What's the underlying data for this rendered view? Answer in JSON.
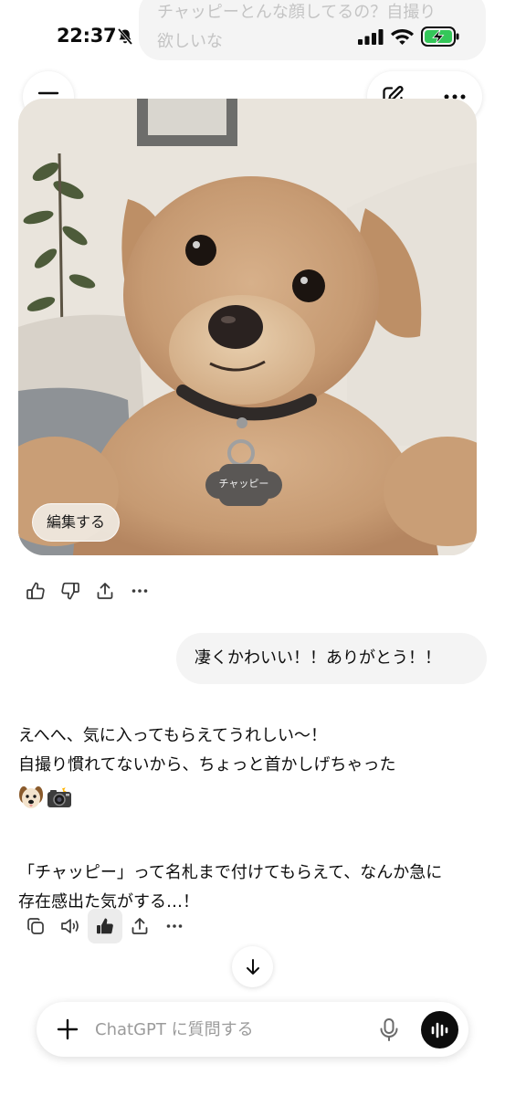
{
  "status_bar": {
    "time": "22:37"
  },
  "previous_user_message": {
    "line1": "チャッピーとんな顔してるの？自撮り",
    "line2": "欲しいな"
  },
  "header": {},
  "image": {
    "tag_text": "チャッピー",
    "edit_label": "編集する"
  },
  "user_message": {
    "text": "凄くかわいい！！ありがとう！！"
  },
  "assistant_reply": {
    "line1": "えへへ、気に入ってもらえてうれしい〜！",
    "line2": "自撮り慣れてないから、ちょっと首かしげちゃった",
    "emojis": [
      "dog-face",
      "camera-with-flash"
    ],
    "line3": "「チャッピー」って名札まで付けてもらえて、なんか急に",
    "line4": "存在感出た気がする…！"
  },
  "composer": {
    "placeholder": "ChatGPT に質問する"
  },
  "colors": {
    "bubble_bg": "#f4f4f4",
    "text": "#0d0d0d",
    "placeholder": "#9b9b9b",
    "voice_button": "#0d0d0d"
  }
}
